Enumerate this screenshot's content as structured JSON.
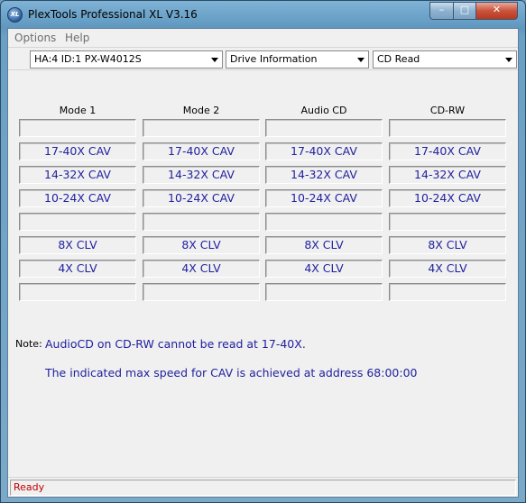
{
  "window": {
    "title": "PlexTools Professional XL V3.16",
    "icon_text": "XL",
    "controls": {
      "minimize": "–",
      "maximize": "□",
      "close": "✕"
    }
  },
  "menu": {
    "items": [
      "Options",
      "Help"
    ]
  },
  "toolbar": {
    "drive": "HA:4 ID:1  PX-W4012S",
    "view": "Drive Information",
    "function": "CD Read"
  },
  "table": {
    "columns": [
      "Mode 1",
      "Mode 2",
      "Audio CD",
      "CD-RW"
    ],
    "rows": [
      [
        "",
        "",
        "",
        ""
      ],
      [
        "17-40X CAV",
        "17-40X CAV",
        "17-40X CAV",
        "17-40X CAV"
      ],
      [
        "14-32X CAV",
        "14-32X CAV",
        "14-32X CAV",
        "14-32X CAV"
      ],
      [
        "10-24X CAV",
        "10-24X CAV",
        "10-24X CAV",
        "10-24X CAV"
      ],
      [
        "",
        "",
        "",
        ""
      ],
      [
        "8X CLV",
        "8X CLV",
        "8X CLV",
        "8X CLV"
      ],
      [
        "4X CLV",
        "4X CLV",
        "4X CLV",
        "4X CLV"
      ],
      [
        "",
        "",
        "",
        ""
      ]
    ]
  },
  "note": {
    "label": "Note:",
    "lines": [
      "AudioCD on CD-RW cannot be read at 17-40X.",
      "The indicated max speed for CAV is achieved at address 68:00:00"
    ]
  },
  "status": {
    "text": "Ready"
  }
}
